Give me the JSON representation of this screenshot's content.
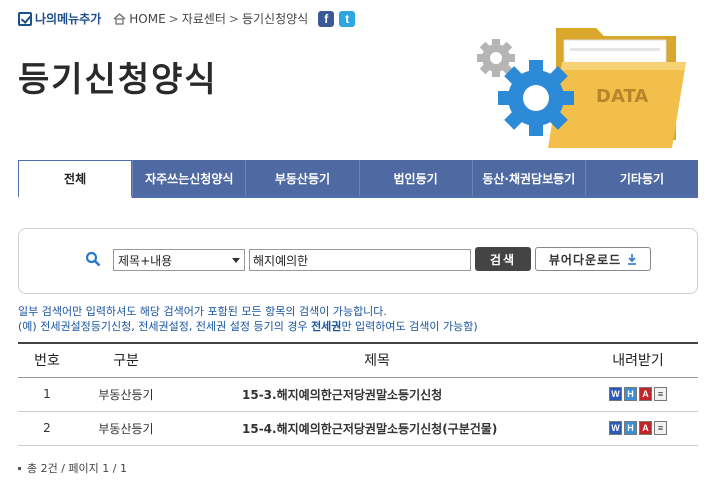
{
  "topbar": {
    "mymenu_label": "나의메뉴추가",
    "breadcrumb": [
      "HOME",
      "자료센터",
      "등기신청양식"
    ]
  },
  "page_title": "등기신청양식",
  "hero": {
    "label": "DATA"
  },
  "tabs": [
    {
      "label": "전체",
      "active": true
    },
    {
      "label": "자주쓰는신청양식",
      "active": false
    },
    {
      "label": "부동산등기",
      "active": false
    },
    {
      "label": "법인등기",
      "active": false
    },
    {
      "label": "동산·채권담보등기",
      "active": false
    },
    {
      "label": "기타등기",
      "active": false
    }
  ],
  "search": {
    "select_value": "제목+내용",
    "keyword_value": "해지예의한",
    "search_button": "검색",
    "viewer_button": "뷰어다운로드"
  },
  "notice": {
    "line1": "일부 검색어만 입력하셔도 해당 검색어가 포함된 모든 항목의 검색이 가능합니다.",
    "line2_prefix": "(예) 전세권설정등기신청, 전세권설정, 전세권 설정 등기의 경우 ",
    "line2_bold": "전세권",
    "line2_suffix": "만 입력하여도 검색이 가능함)"
  },
  "table": {
    "headers": {
      "no": "번호",
      "category": "구분",
      "title": "제목",
      "download": "내려받기"
    },
    "rows": [
      {
        "no": "1",
        "category": "부동산등기",
        "title": "15-3.해지예의한근저당권말소등기신청"
      },
      {
        "no": "2",
        "category": "부동산등기",
        "title": "15-4.해지예의한근저당권말소등기신청(구분건물)"
      }
    ]
  },
  "pageinfo": "총 2건 / 페이지 1 / 1",
  "colors": {
    "tab_bg": "#4f6aa3",
    "notice": "#1a55a0",
    "search_btn": "#444444"
  }
}
